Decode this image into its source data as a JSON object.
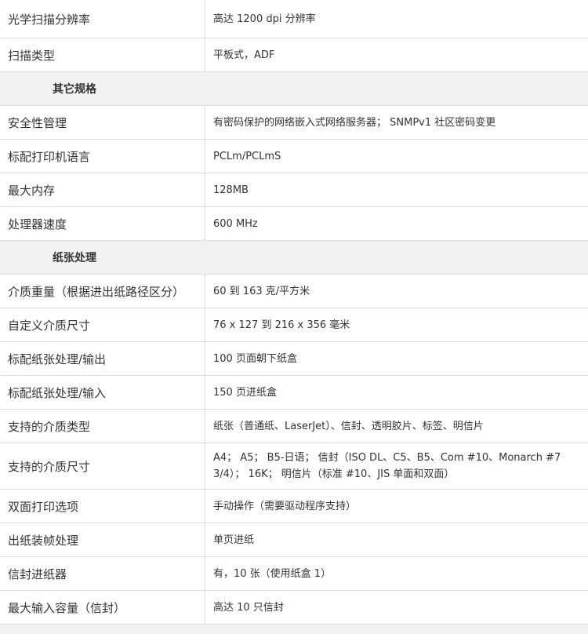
{
  "rows": [
    {
      "type": "spec",
      "label": "光学扫描分辨率",
      "value": "高达 1200 dpi 分辨率"
    },
    {
      "type": "spec",
      "label": "扫描类型",
      "value": "平板式，ADF"
    },
    {
      "type": "section",
      "title": "其它规格"
    },
    {
      "type": "spec",
      "label": "安全性管理",
      "value": "有密码保护的网络嵌入式网络服务器； SNMPv1 社区密码变更"
    },
    {
      "type": "spec",
      "label": "标配打印机语言",
      "value": "PCLm/PCLmS"
    },
    {
      "type": "spec",
      "label": "最大内存",
      "value": "128MB"
    },
    {
      "type": "spec",
      "label": "处理器速度",
      "value": "600 MHz"
    },
    {
      "type": "section",
      "title": "纸张处理"
    },
    {
      "type": "spec",
      "label": "介质重量（根据进出纸路径区分）",
      "value": "60 到 163 克/平方米"
    },
    {
      "type": "spec",
      "label": "自定义介质尺寸",
      "value": "76 x 127 到 216 x 356 毫米"
    },
    {
      "type": "spec",
      "label": "标配纸张处理/输出",
      "value": "100 页面朝下纸盒"
    },
    {
      "type": "spec",
      "label": "标配纸张处理/输入",
      "value": "150 页进纸盒"
    },
    {
      "type": "spec",
      "label": "支持的介质类型",
      "value": "纸张（普通纸、LaserJet）、信封、透明胶片、标签、明信片"
    },
    {
      "type": "spec",
      "label": "支持的介质尺寸",
      "value": "A4； A5； B5-日语； 信封（ISO DL、C5、B5、Com #10、Monarch #7 3/4）； 16K； 明信片（标准 #10、JIS 单面和双面）"
    },
    {
      "type": "spec",
      "label": "双面打印选项",
      "value": "手动操作（需要驱动程序支持）"
    },
    {
      "type": "spec",
      "label": "出纸装帧处理",
      "value": "单页进纸"
    },
    {
      "type": "spec",
      "label": "信封进纸器",
      "value": "有，10 张（使用纸盒 1）"
    },
    {
      "type": "spec",
      "label": "最大输入容量（信封）",
      "value": "高达 10 只信封"
    }
  ]
}
